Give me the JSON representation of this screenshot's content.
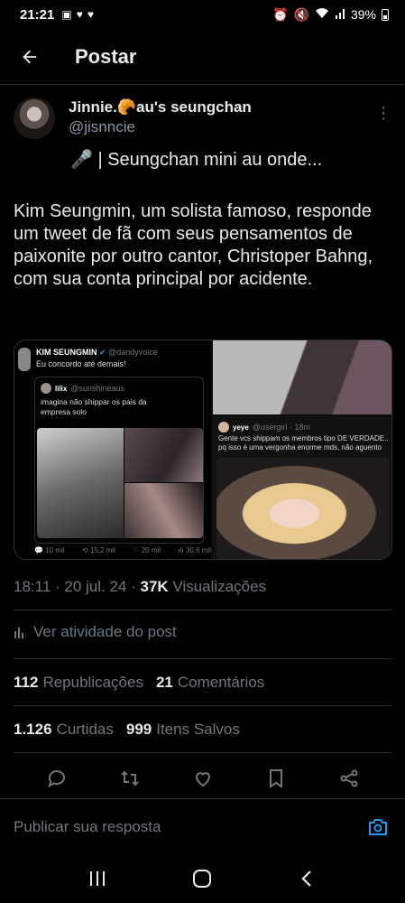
{
  "status_bar": {
    "time": "21:21",
    "battery": "39%"
  },
  "header": {
    "title": "Postar"
  },
  "tweet": {
    "display_name": "Jinnie.🥐au's seungchan",
    "handle": "@jisnncie",
    "teaser": "🎤 | Seungchan mini au onde...",
    "text": "Kim Seungmin, um solista famoso, responde um tweet de fã com seus pensamentos de paixonite por outro cantor, Christoper Bahng, com sua conta principal por acidente.",
    "time": "18:11 · 20 jul. 24 · ",
    "views_count": "37K",
    "views_label": "Visualizações"
  },
  "media": {
    "left_post": {
      "name": "KIM SEUNGMIN",
      "handle": "@dandyvoice",
      "text": "Eu concordo até demais!",
      "quote_name": "lilix",
      "quote_handle": "@sunshineaus",
      "quote_text": "imagina não shippar os pais da empresa solo",
      "replies": "10 mil",
      "retweets": "15,2 mil",
      "likes": "20 mil",
      "views": "30,6 mil"
    },
    "right_post": {
      "name": "yeye",
      "handle": "@usergirl · 18m",
      "text": "Gente vcs shippam os membros tipo DE VERDADE.. pq isso é uma vergonha enorme mds, não aguento"
    }
  },
  "activity": {
    "label": "Ver atividade do post"
  },
  "stats": {
    "reposts_count": "112",
    "reposts_label": "Republicações",
    "comments_count": "21",
    "comments_label": "Comentários",
    "likes_count": "1.126",
    "likes_label": "Curtidas",
    "saves_count": "999",
    "saves_label": "Itens Salvos"
  },
  "reply": {
    "placeholder": "Publicar sua resposta"
  },
  "colors": {
    "background": "#000000",
    "text": "#e7e9ea",
    "muted": "#71767b",
    "accent": "#1d9bf0",
    "divider": "#2f3336"
  }
}
